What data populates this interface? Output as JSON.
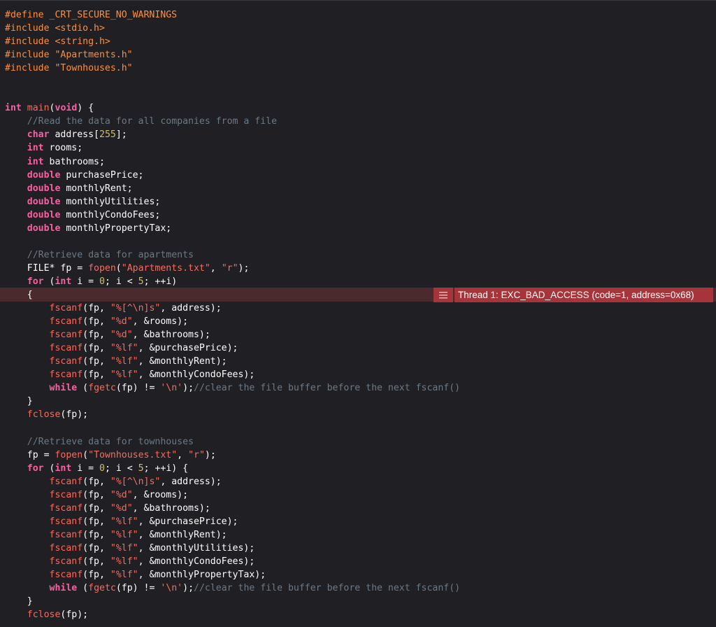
{
  "editor": {
    "error_badge": {
      "icon": "list-icon",
      "message": "Thread 1: EXC_BAD_ACCESS (code=1, address=0x68)"
    },
    "lines": [
      [
        [
          "pp",
          "#define _CRT_SECURE_NO_WARNINGS"
        ]
      ],
      [
        [
          "pp",
          "#include <stdio.h>"
        ]
      ],
      [
        [
          "pp",
          "#include <string.h>"
        ]
      ],
      [
        [
          "pp",
          "#include \"Apartments.h\""
        ]
      ],
      [
        [
          "pp",
          "#include \"Townhouses.h\""
        ]
      ],
      [],
      [],
      [
        [
          "kw",
          "int"
        ],
        [
          "id",
          " "
        ],
        [
          "call",
          "main"
        ],
        [
          "id",
          "("
        ],
        [
          "kw",
          "void"
        ],
        [
          "id",
          ") {"
        ]
      ],
      [
        [
          "id",
          "    "
        ],
        [
          "cm",
          "//Read the data for all companies from a file"
        ]
      ],
      [
        [
          "id",
          "    "
        ],
        [
          "kw",
          "char"
        ],
        [
          "id",
          " address["
        ],
        [
          "num",
          "255"
        ],
        [
          "id",
          "];"
        ]
      ],
      [
        [
          "id",
          "    "
        ],
        [
          "kw",
          "int"
        ],
        [
          "id",
          " rooms;"
        ]
      ],
      [
        [
          "id",
          "    "
        ],
        [
          "kw",
          "int"
        ],
        [
          "id",
          " bathrooms;"
        ]
      ],
      [
        [
          "id",
          "    "
        ],
        [
          "kw",
          "double"
        ],
        [
          "id",
          " purchasePrice;"
        ]
      ],
      [
        [
          "id",
          "    "
        ],
        [
          "kw",
          "double"
        ],
        [
          "id",
          " monthlyRent;"
        ]
      ],
      [
        [
          "id",
          "    "
        ],
        [
          "kw",
          "double"
        ],
        [
          "id",
          " monthlyUtilities;"
        ]
      ],
      [
        [
          "id",
          "    "
        ],
        [
          "kw",
          "double"
        ],
        [
          "id",
          " monthlyCondoFees;"
        ]
      ],
      [
        [
          "id",
          "    "
        ],
        [
          "kw",
          "double"
        ],
        [
          "id",
          " monthlyPropertyTax;"
        ]
      ],
      [],
      [
        [
          "id",
          "    "
        ],
        [
          "cm",
          "//Retrieve data for apartments"
        ]
      ],
      [
        [
          "id",
          "    FILE* fp = "
        ],
        [
          "call",
          "fopen"
        ],
        [
          "id",
          "("
        ],
        [
          "str",
          "\"Apartments.txt\""
        ],
        [
          "id",
          ", "
        ],
        [
          "str",
          "\"r\""
        ],
        [
          "id",
          ");"
        ]
      ],
      [
        [
          "id",
          "    "
        ],
        [
          "kw",
          "for"
        ],
        [
          "id",
          " ("
        ],
        [
          "kw",
          "int"
        ],
        [
          "id",
          " i = "
        ],
        [
          "num",
          "0"
        ],
        [
          "id",
          "; i < "
        ],
        [
          "num",
          "5"
        ],
        [
          "id",
          "; ++i)"
        ]
      ],
      [
        [
          "id",
          "    {"
        ]
      ],
      [
        [
          "id",
          "        "
        ],
        [
          "call",
          "fscanf"
        ],
        [
          "id",
          "(fp, "
        ],
        [
          "str",
          "\"%[^\\n]s\""
        ],
        [
          "id",
          ", address);"
        ]
      ],
      [
        [
          "id",
          "        "
        ],
        [
          "call",
          "fscanf"
        ],
        [
          "id",
          "(fp, "
        ],
        [
          "str",
          "\"%d\""
        ],
        [
          "id",
          ", &rooms);"
        ]
      ],
      [
        [
          "id",
          "        "
        ],
        [
          "call",
          "fscanf"
        ],
        [
          "id",
          "(fp, "
        ],
        [
          "str",
          "\"%d\""
        ],
        [
          "id",
          ", &bathrooms);"
        ]
      ],
      [
        [
          "id",
          "        "
        ],
        [
          "call",
          "fscanf"
        ],
        [
          "id",
          "(fp, "
        ],
        [
          "str",
          "\"%lf\""
        ],
        [
          "id",
          ", &purchasePrice);"
        ]
      ],
      [
        [
          "id",
          "        "
        ],
        [
          "call",
          "fscanf"
        ],
        [
          "id",
          "(fp, "
        ],
        [
          "str",
          "\"%lf\""
        ],
        [
          "id",
          ", &monthlyRent);"
        ]
      ],
      [
        [
          "id",
          "        "
        ],
        [
          "call",
          "fscanf"
        ],
        [
          "id",
          "(fp, "
        ],
        [
          "str",
          "\"%lf\""
        ],
        [
          "id",
          ", &monthlyCondoFees);"
        ]
      ],
      [
        [
          "id",
          "        "
        ],
        [
          "kw",
          "while"
        ],
        [
          "id",
          " ("
        ],
        [
          "call",
          "fgetc"
        ],
        [
          "id",
          "(fp) != "
        ],
        [
          "str",
          "'\\n'"
        ],
        [
          "id",
          ");"
        ],
        [
          "cm",
          "//clear the file buffer before the next fscanf()"
        ]
      ],
      [
        [
          "id",
          "    }"
        ]
      ],
      [
        [
          "id",
          "    "
        ],
        [
          "call",
          "fclose"
        ],
        [
          "id",
          "(fp);"
        ]
      ],
      [],
      [
        [
          "id",
          "    "
        ],
        [
          "cm",
          "//Retrieve data for townhouses"
        ]
      ],
      [
        [
          "id",
          "    fp = "
        ],
        [
          "call",
          "fopen"
        ],
        [
          "id",
          "("
        ],
        [
          "str",
          "\"Townhouses.txt\""
        ],
        [
          "id",
          ", "
        ],
        [
          "str",
          "\"r\""
        ],
        [
          "id",
          ");"
        ]
      ],
      [
        [
          "id",
          "    "
        ],
        [
          "kw",
          "for"
        ],
        [
          "id",
          " ("
        ],
        [
          "kw",
          "int"
        ],
        [
          "id",
          " i = "
        ],
        [
          "num",
          "0"
        ],
        [
          "id",
          "; i < "
        ],
        [
          "num",
          "5"
        ],
        [
          "id",
          "; ++i) {"
        ]
      ],
      [
        [
          "id",
          "        "
        ],
        [
          "call",
          "fscanf"
        ],
        [
          "id",
          "(fp, "
        ],
        [
          "str",
          "\"%[^\\n]s\""
        ],
        [
          "id",
          ", address);"
        ]
      ],
      [
        [
          "id",
          "        "
        ],
        [
          "call",
          "fscanf"
        ],
        [
          "id",
          "(fp, "
        ],
        [
          "str",
          "\"%d\""
        ],
        [
          "id",
          ", &rooms);"
        ]
      ],
      [
        [
          "id",
          "        "
        ],
        [
          "call",
          "fscanf"
        ],
        [
          "id",
          "(fp, "
        ],
        [
          "str",
          "\"%d\""
        ],
        [
          "id",
          ", &bathrooms);"
        ]
      ],
      [
        [
          "id",
          "        "
        ],
        [
          "call",
          "fscanf"
        ],
        [
          "id",
          "(fp, "
        ],
        [
          "str",
          "\"%lf\""
        ],
        [
          "id",
          ", &purchasePrice);"
        ]
      ],
      [
        [
          "id",
          "        "
        ],
        [
          "call",
          "fscanf"
        ],
        [
          "id",
          "(fp, "
        ],
        [
          "str",
          "\"%lf\""
        ],
        [
          "id",
          ", &monthlyRent);"
        ]
      ],
      [
        [
          "id",
          "        "
        ],
        [
          "call",
          "fscanf"
        ],
        [
          "id",
          "(fp, "
        ],
        [
          "str",
          "\"%lf\""
        ],
        [
          "id",
          ", &monthlyUtilities);"
        ]
      ],
      [
        [
          "id",
          "        "
        ],
        [
          "call",
          "fscanf"
        ],
        [
          "id",
          "(fp, "
        ],
        [
          "str",
          "\"%lf\""
        ],
        [
          "id",
          ", &monthlyCondoFees);"
        ]
      ],
      [
        [
          "id",
          "        "
        ],
        [
          "call",
          "fscanf"
        ],
        [
          "id",
          "(fp, "
        ],
        [
          "str",
          "\"%lf\""
        ],
        [
          "id",
          ", &monthlyPropertyTax);"
        ]
      ],
      [
        [
          "id",
          "        "
        ],
        [
          "kw",
          "while"
        ],
        [
          "id",
          " ("
        ],
        [
          "call",
          "fgetc"
        ],
        [
          "id",
          "(fp) != "
        ],
        [
          "str",
          "'\\n'"
        ],
        [
          "id",
          ");"
        ],
        [
          "cm",
          "//clear the file buffer before the next fscanf()"
        ]
      ],
      [
        [
          "id",
          "    }"
        ]
      ],
      [
        [
          "id",
          "    "
        ],
        [
          "call",
          "fclose"
        ],
        [
          "id",
          "(fp);"
        ]
      ]
    ]
  }
}
